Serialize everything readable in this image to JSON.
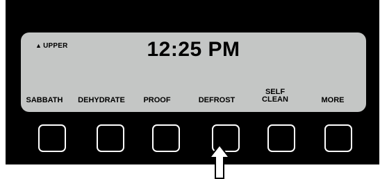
{
  "display": {
    "zone_indicator": "UPPER",
    "zone_icon": "up-triangle",
    "time": "12:25 PM"
  },
  "softkeys": [
    {
      "label": "SABBATH"
    },
    {
      "label": "DEHYDRATE"
    },
    {
      "label": "PROOF"
    },
    {
      "label": "DEFROST"
    },
    {
      "label": "SELF CLEAN"
    },
    {
      "label": "MORE"
    }
  ],
  "pointer": {
    "icon": "up-arrow",
    "target": "DEFROST"
  },
  "colors": {
    "panel": "#000000",
    "lcd": "#c4c6c5",
    "key_outline": "#ffffff"
  }
}
